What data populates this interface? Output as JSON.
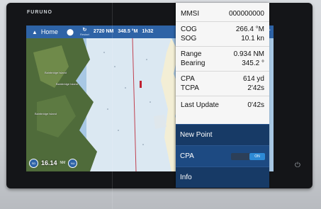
{
  "device": {
    "brand": "FURUNO",
    "power_icon": "power-icon"
  },
  "statusbar": {
    "home_label": "Home",
    "home_icon": "home-icon",
    "location_icon": "location-pin-icon",
    "restart_label": "Restart",
    "rng": "2720 NM",
    "brg": "348.5 °M",
    "ttg": "1h32",
    "plus_icon": "plus-icon"
  },
  "map": {
    "labels": [
      "Bainbridge Island",
      "Bainbridge Island",
      "Bainbridge Island"
    ],
    "range_button": "SD",
    "range_value": "16.14",
    "range_unit": "NM",
    "north_button": "NU"
  },
  "target_info": {
    "mmsi_label": "MMSI",
    "mmsi_value": "000000000",
    "cog_label": "COG",
    "cog_value": "266.4 °M",
    "sog_label": "SOG",
    "sog_value": "10.1 kn",
    "range_label": "Range",
    "range_value": "0.934 NM",
    "bearing_label": "Bearing",
    "bearing_value": "345.2 °",
    "cpa_label": "CPA",
    "cpa_value": "614 yd",
    "tcpa_label": "TCPA",
    "tcpa_value": "2'42s",
    "last_update_label": "Last Update",
    "last_update_value": "0'42s"
  },
  "menu": {
    "new_point": "New Point",
    "cpa": "CPA",
    "cpa_toggle": "ON",
    "info": "Info"
  },
  "colors": {
    "statusbar": "#2e63a6",
    "menu_bg": "#173a66",
    "toggle_on": "#2d8ad6",
    "water": "#a8c8e4",
    "land": "#4f6b3a"
  }
}
